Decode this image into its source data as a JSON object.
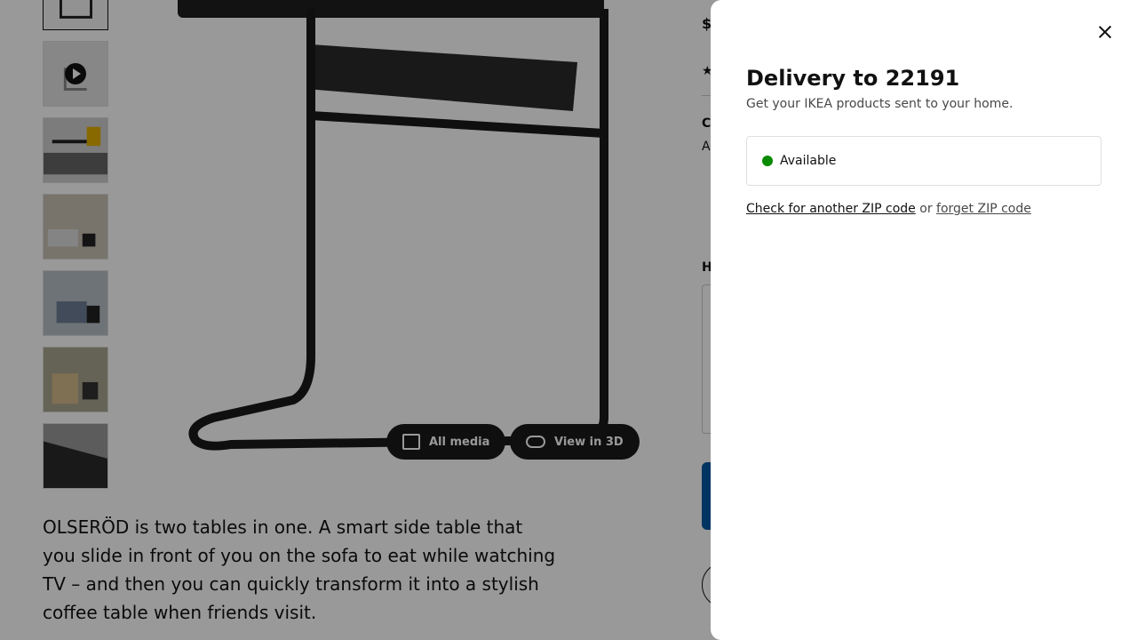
{
  "modal": {
    "title": "Delivery to 22191",
    "subtitle": "Get your IKEA products sent to your home.",
    "availability": "Available",
    "check_link": "Check for another ZIP code",
    "or_text": " or ",
    "forget_link": "forget ZIP code",
    "available_color": "#0a8a00"
  },
  "gallery": {
    "all_media": "All media",
    "view_3d": "View in 3D"
  },
  "product": {
    "description": "OLSERÖD is two tables in one. A smart side table that you slide in front of you on the sofa to eat while watching TV – and then you can quickly transform it into a stylish coffee table when friends visit."
  },
  "right_column": {
    "price_prefix": "$",
    "section_c": "C",
    "section_a": "A",
    "section_h": "H"
  }
}
